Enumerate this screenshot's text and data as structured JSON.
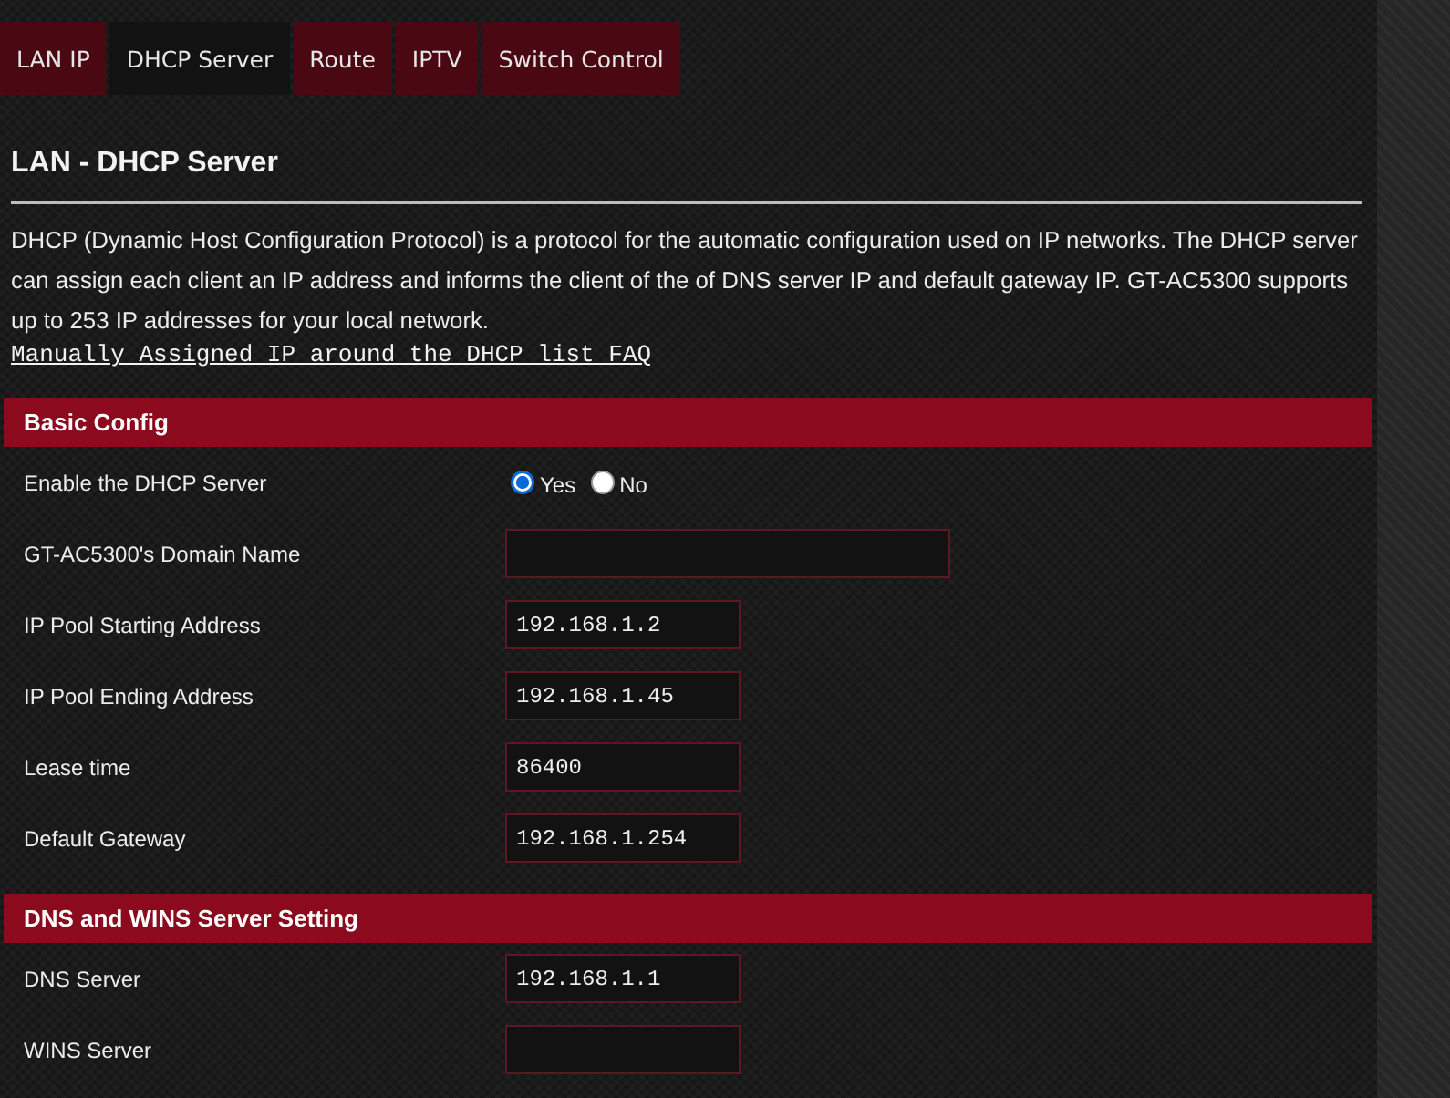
{
  "tabs": [
    {
      "label": "LAN IP",
      "selected": false
    },
    {
      "label": "DHCP Server",
      "selected": true
    },
    {
      "label": "Route",
      "selected": false
    },
    {
      "label": "IPTV",
      "selected": false
    },
    {
      "label": "Switch Control",
      "selected": false
    }
  ],
  "page_title": "LAN - DHCP Server",
  "description": "DHCP (Dynamic Host Configuration Protocol) is a protocol for the automatic configuration used on IP networks. The DHCP server can assign each client an IP address and informs the client of the of DNS server IP and default gateway IP. GT-AC5300 supports up to 253 IP addresses for your local network.",
  "faq_link": "Manually Assigned IP around the DHCP list FAQ",
  "sections": [
    {
      "title": "Basic Config",
      "rows": [
        {
          "kind": "radio",
          "label": "Enable the DHCP Server",
          "options": [
            {
              "label": "Yes",
              "selected": true
            },
            {
              "label": "No",
              "selected": false
            }
          ]
        },
        {
          "kind": "long_text",
          "label": "GT-AC5300's Domain Name"
        },
        {
          "kind": "text",
          "label": "IP Pool Starting Address",
          "value": "192.168.1.2"
        },
        {
          "kind": "text",
          "label": "IP Pool Ending Address",
          "value": "192.168.1.45"
        },
        {
          "kind": "text",
          "label": "Lease time",
          "value": "86400"
        },
        {
          "kind": "text",
          "label": "Default Gateway",
          "value": "192.168.1.254"
        }
      ]
    },
    {
      "title": "DNS and WINS Server Setting",
      "rows": [
        {
          "kind": "text",
          "label": "DNS Server",
          "value": "192.168.1.1"
        },
        {
          "kind": "text",
          "label": "WINS Server"
        }
      ]
    }
  ]
}
